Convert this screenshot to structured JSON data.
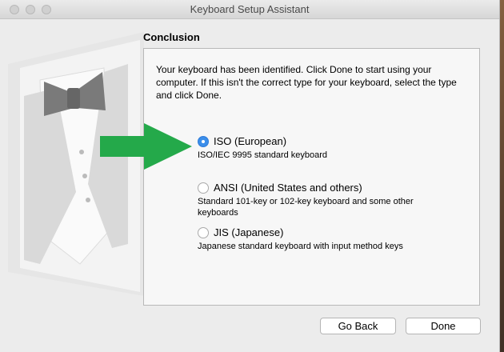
{
  "window": {
    "title": "Keyboard Setup Assistant"
  },
  "page": {
    "heading": "Conclusion",
    "description": "Your keyboard has been identified. Click Done to start using your computer. If this isn't the correct type for your keyboard, select the type and click Done."
  },
  "options": [
    {
      "label": "ISO (European)",
      "description": "ISO/IEC 9995 standard keyboard",
      "selected": true
    },
    {
      "label": "ANSI (United States and others)",
      "description": "Standard 101-key or 102-key keyboard and some other keyboards",
      "selected": false
    },
    {
      "label": "JIS (Japanese)",
      "description": "Japanese standard keyboard with input method keys",
      "selected": false
    }
  ],
  "buttons": {
    "back": "Go Back",
    "done": "Done"
  },
  "colors": {
    "accent": "#3b8eea",
    "arrow": "#24a94a"
  },
  "icons": {
    "annotation": "green-arrow-icon",
    "illustration": "tuxedo-illustration"
  }
}
